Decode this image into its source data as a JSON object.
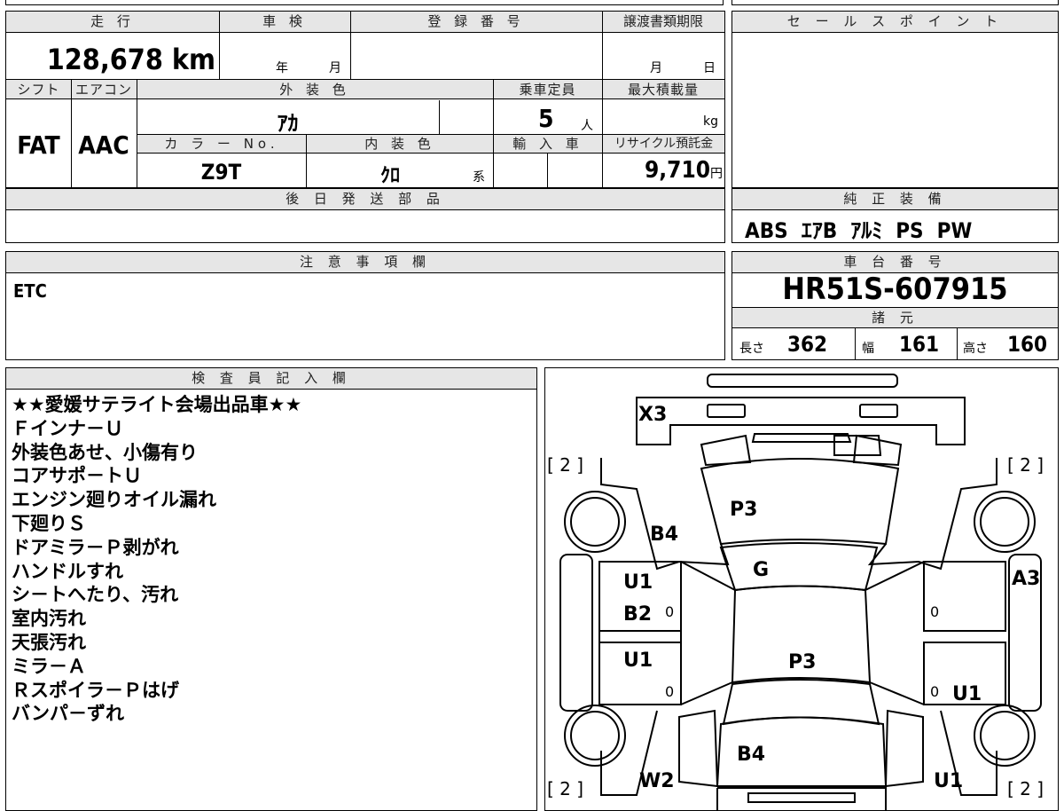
{
  "sheet": {
    "mileage": {
      "label": "走 行",
      "value": "128,678",
      "unit": "km"
    },
    "inspection": {
      "label": "車 検",
      "year_unit": "年",
      "month_unit": "月"
    },
    "registration": {
      "label": "登 録 番 号",
      "value": ""
    },
    "transfer_deadline": {
      "label": "譲渡書類期限",
      "month_unit": "月",
      "day_unit": "日"
    },
    "shift": {
      "label": "シフト",
      "value": "FAT"
    },
    "aircon": {
      "label": "エアコン",
      "value": "AAC"
    },
    "exterior_color": {
      "label": "外 装 色",
      "value": "ｱｶ"
    },
    "color_no": {
      "label": "カ ラ ー No.",
      "value": "Z9T"
    },
    "interior_color": {
      "label": "内 装 色",
      "value": "ｸﾛ",
      "suffix": "系"
    },
    "capacity": {
      "label": "乗車定員",
      "value": "5",
      "unit": "人"
    },
    "max_load": {
      "label": "最大積載量",
      "value": "",
      "unit": "kg"
    },
    "import": {
      "label": "輸 入 車",
      "value": ""
    },
    "recycle": {
      "label": "リサイクル預託金",
      "value": "9,710",
      "unit": "円"
    },
    "later_parts": {
      "label": "後 日 発 送 部 品",
      "value": ""
    },
    "sales_points": {
      "label": "セ ー ル ス ポ イ ン ト",
      "value": ""
    },
    "genuine_equipment": {
      "label": "純 正 装 備",
      "value": "ABS  ｴｱB  ｱﾙﾐ  PS  PW"
    },
    "notes": {
      "label": "注 意 事 項 欄",
      "value": "ETC"
    },
    "chassis": {
      "label": "車 台 番 号",
      "value": "HR51S-607915"
    },
    "specs": {
      "label": "諸 元",
      "length_label": "長さ",
      "length": "362",
      "width_label": "幅",
      "width": "161",
      "height_label": "高さ",
      "height": "160"
    },
    "inspector": {
      "label": "検 査 員 記 入 欄",
      "lines": [
        "★★愛媛サテライト会場出品車★★",
        "Ｆインナ－Ｕ",
        "外装色あせ、小傷有り",
        "コアサポ－トＵ",
        "エンジン廻りオイル漏れ",
        "下廻りＳ",
        "ドアミラ－Ｐ剥がれ",
        "ハンドルすれ",
        "シ－トへたり、汚れ",
        "室内汚れ",
        "天張汚れ",
        "ミラ－Ａ",
        "Ｒスポイラ－Ｐはげ",
        "バンパ－ずれ"
      ]
    }
  },
  "diagram": {
    "marks": {
      "front_bumper": "X3",
      "hood": "P3",
      "left_front_fender": "B4",
      "windshield": "G",
      "left_front_door": "U1",
      "left_front_door_2": "B2",
      "left_rear_door": "U1",
      "roof": "P3",
      "right_front_door": "A3",
      "right_rear_door": "U1",
      "trunk": "B4",
      "left_rear_quarter": "W2",
      "right_rear_quarter": "U1"
    },
    "tire_labels": [
      "[ 2 ]",
      "[ 2 ]",
      "[ 2 ]",
      "[ 2 ]"
    ],
    "door_marks": [
      "0",
      "0",
      "0",
      "0"
    ]
  }
}
